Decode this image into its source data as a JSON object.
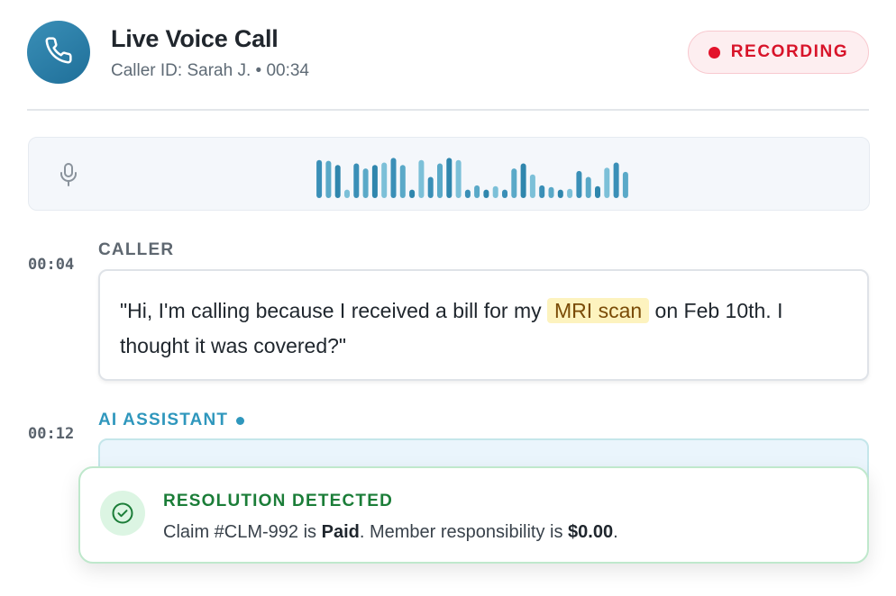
{
  "header": {
    "title": "Live Voice Call",
    "caller_prefix": "Caller ID: ",
    "caller_name": "Sarah J.",
    "separator": " • ",
    "duration": "00:34",
    "recording_label": "RECORDING",
    "icon": "phone-icon"
  },
  "waveform": {
    "icon": "microphone-icon",
    "levels": [
      0.9,
      0.88,
      0.78,
      0.2,
      0.82,
      0.7,
      0.78,
      0.84,
      0.95,
      0.78,
      0.2,
      0.9,
      0.5,
      0.82,
      0.95,
      0.9,
      0.2,
      0.3,
      0.2,
      0.28,
      0.2,
      0.7,
      0.82,
      0.56,
      0.3,
      0.26,
      0.2,
      0.22,
      0.64,
      0.5,
      0.28,
      0.72,
      0.84,
      0.62
    ]
  },
  "transcript": [
    {
      "time": "00:04",
      "speaker": "CALLER",
      "text_before": "\"Hi, I'm calling because I received a bill for my ",
      "highlight": "MRI scan",
      "text_after": " on Feb 10th. I thought it was covered?\""
    },
    {
      "time": "00:12",
      "speaker": "AI ASSISTANT",
      "text": ""
    }
  ],
  "toast": {
    "title": "RESOLUTION DETECTED",
    "icon": "check-circle-icon",
    "body_1": "Claim #CLM-992 is ",
    "body_bold_1": "Paid",
    "body_2": ". Member responsibility is ",
    "body_bold_2": "$0.00",
    "body_3": "."
  },
  "colors": {
    "accent": "#2f97bd",
    "recording": "#e3132b",
    "success": "#1b7d38",
    "highlight_bg": "#fdf3bf"
  }
}
